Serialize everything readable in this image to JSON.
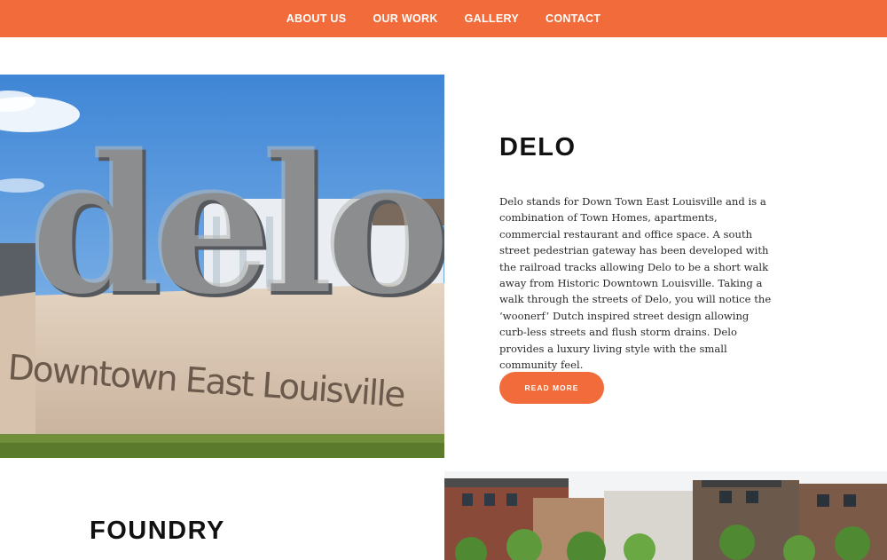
{
  "nav": {
    "items": [
      {
        "label": "ABOUT US"
      },
      {
        "label": "OUR WORK"
      },
      {
        "label": "GALLERY"
      },
      {
        "label": "CONTACT"
      }
    ]
  },
  "colors": {
    "accent": "#f26b3a",
    "heading": "#111111",
    "body_text": "#2a2a2a"
  },
  "delo": {
    "title": "DELO",
    "description": "Delo stands for Down Town East Louisville and is a combination of Town Homes, apartments, commercial restaurant and office space. A south street pedestrian gateway has been developed with the railroad tracks allowing Delo to be a short walk away from Historic Downtown Louisville. Taking a walk through the streets of Delo, you will notice the ‘woonerf’ Dutch inspired street design allowing curb-less streets and flush storm drains. Delo provides a luxury living style with the small community feel.",
    "button_label": "READ MORE",
    "image": {
      "sign_letters": "delo",
      "sign_subtitle": "Downtown East Louisville"
    }
  },
  "foundry": {
    "title": "FOUNDRY"
  }
}
